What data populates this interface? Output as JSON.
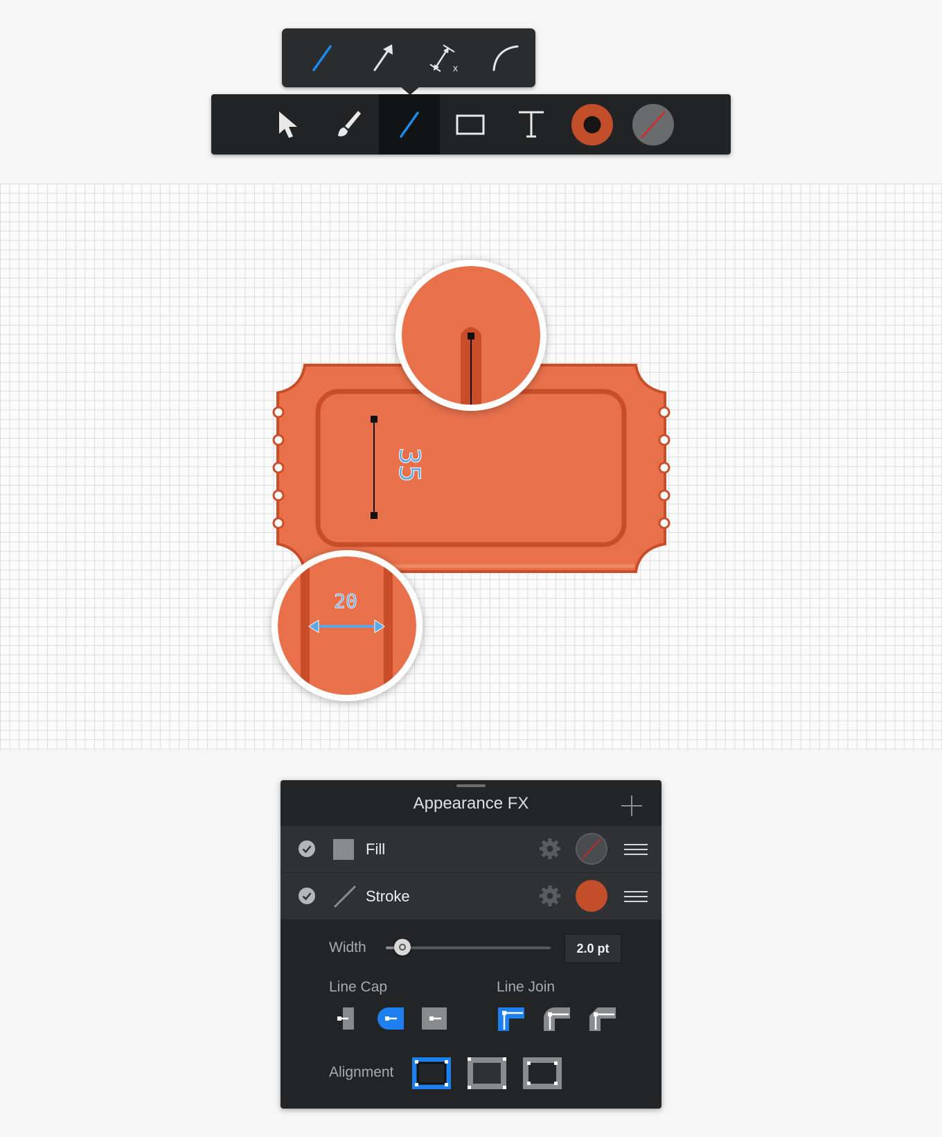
{
  "line_popover": {
    "tools": [
      {
        "name": "line-tool-icon",
        "active": true
      },
      {
        "name": "arrow-tool-icon",
        "active": false
      },
      {
        "name": "dimension-tool-icon",
        "active": false
      },
      {
        "name": "arc-tool-icon",
        "active": false
      }
    ]
  },
  "toolbar": {
    "tools": [
      {
        "name": "select-arrow-icon",
        "active": false
      },
      {
        "name": "brush-icon",
        "active": false
      },
      {
        "name": "line-tool-icon",
        "active": true
      },
      {
        "name": "rectangle-icon",
        "active": false
      },
      {
        "name": "text-icon",
        "active": false
      },
      {
        "name": "stroke-color-swatch",
        "active": false
      },
      {
        "name": "fill-color-swatch",
        "active": false
      }
    ],
    "stroke_color": "#c34e2a",
    "fill_color": "none"
  },
  "canvas": {
    "ticket_color": "#e8714b",
    "ticket_stroke_color": "#c94d28",
    "dimension_height": "35",
    "dimension_width": "20",
    "dimension_color": "#5aa7e6"
  },
  "appearance": {
    "title": "Appearance FX",
    "rows": [
      {
        "label": "Fill",
        "enabled": true,
        "swatch": "none"
      },
      {
        "label": "Stroke",
        "enabled": true,
        "swatch": "#c34e2a"
      }
    ],
    "width_label": "Width",
    "width_value": "2.0 pt",
    "width_fraction": 0.1,
    "line_cap_label": "Line Cap",
    "line_cap_options": [
      "butt-cap-icon",
      "round-cap-icon",
      "square-cap-icon"
    ],
    "line_cap_selected": 1,
    "line_join_label": "Line Join",
    "line_join_options": [
      "miter-join-icon",
      "round-join-icon",
      "bevel-join-icon"
    ],
    "line_join_selected": 0,
    "alignment_label": "Alignment",
    "alignment_options": [
      "align-center-icon",
      "align-inside-icon",
      "align-outside-icon"
    ],
    "alignment_selected": 0,
    "accent_color": "#1e7ff0"
  }
}
